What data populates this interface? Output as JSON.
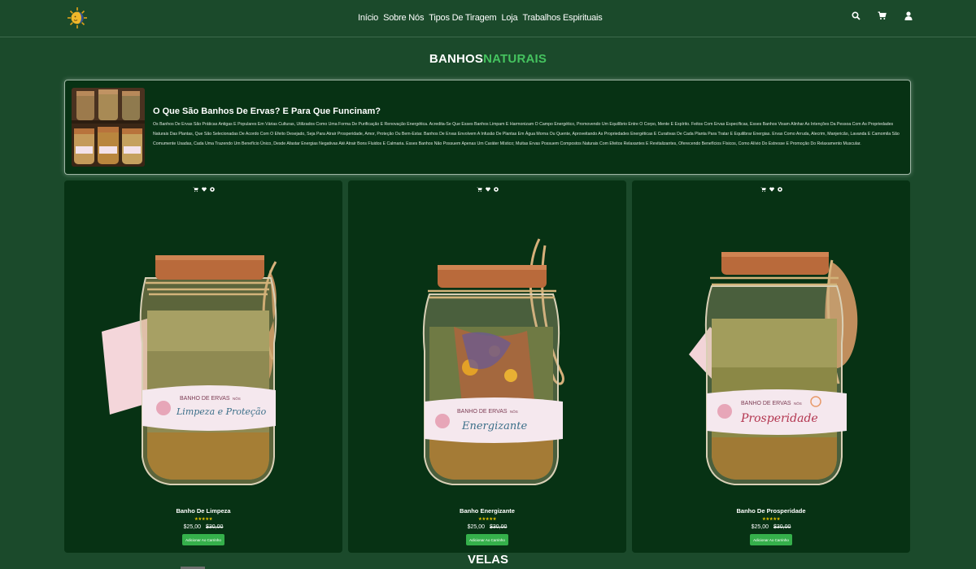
{
  "nav": {
    "items": [
      "Início",
      "Sobre Nós",
      "Tipos De Tiragem",
      "Loja",
      "Trabalhos Espirituais"
    ]
  },
  "header_icons": [
    "search-icon",
    "cart-icon",
    "user-icon"
  ],
  "page_title": {
    "part1": "BANHOS",
    "part2": "NATURAIS"
  },
  "colors": {
    "background": "#1b4a2b",
    "card": "#073214",
    "accent": "#45c35f",
    "button": "#35b04b",
    "stars": "#e9c300"
  },
  "info": {
    "title": "O Que São Banhos De Ervas? E Para Que Funcinam?",
    "text": "Os Banhos De Ervas São Práticas Antigas E Populares Em Várias Culturas, Utilizados Como Uma Forma De Purificação E Renovação Energética. Acredita-Se Que Esses Banhos Limpam E Harmonizam O Campo Energético, Promovendo Um Equilíbrio Entre O Corpo, Mente E Espírito. Feitos Com Ervas Específicas, Esses Banhos Visam Alinhar As Intenções Da Pessoa Com As Propriedades Naturais Das Plantas, Que São Selecionadas De Acordo Com O Efeito Desejado, Seja Para Atrair Prosperidade, Amor, Proteção Ou Bem-Estar. Banhos De Ervas Envolvem A Infusão De Plantas Em Água Morna Ou Quente, Aproveitando As Propriedades Energéticas E Curativas De Cada Planta Para Tratar E Equilibrar Energias. Ervas Como Arruda, Alecrim, Manjericão, Lavanda E Camomila São Comumente Usadas, Cada Uma Trazendo Um Benefício Único, Desde Afastar Energias Negativas Até Atrair Bons Fluidos E Calmaria. Esses Banhos Não Possuem Apenas Um Caráter Místico; Muitas Ervas Possuem Compostos Naturais Com Efeitos Relaxantes E Revitalizantes, Oferecendo Benefícios Físicos, Como Alívio Do Estresse E Promoção Do Relaxamento Muscular."
  },
  "products": [
    {
      "name": "Banho De Limpeza",
      "stars": "★★★★★",
      "rating": 4.5,
      "price": "$25,00",
      "old_price": "$30,00",
      "button": "Adicionar Ao Carrinho",
      "jar_label_brand": "BANHO DE ERVAS",
      "jar_label_tag": "NÔS",
      "jar_label_name": "Limpeza e Proteção"
    },
    {
      "name": "Banho Energizante",
      "stars": "★★★★★",
      "rating": 4.5,
      "price": "$25,00",
      "old_price": "$30,00",
      "button": "Adicionar Ao Carrinho",
      "jar_label_brand": "BANHO DE ERVAS",
      "jar_label_tag": "NÔS",
      "jar_label_name": "Energizante"
    },
    {
      "name": "Banho De Prosperidade",
      "stars": "★★★★★",
      "rating": 4.5,
      "price": "$25,00",
      "old_price": "$30,00",
      "button": "Adicionar Ao Carrinho",
      "jar_label_brand": "BANHO DE ERVAS",
      "jar_label_tag": "NÔS",
      "jar_label_name": "Prosperidade"
    }
  ],
  "next_section_title": "VELAS"
}
